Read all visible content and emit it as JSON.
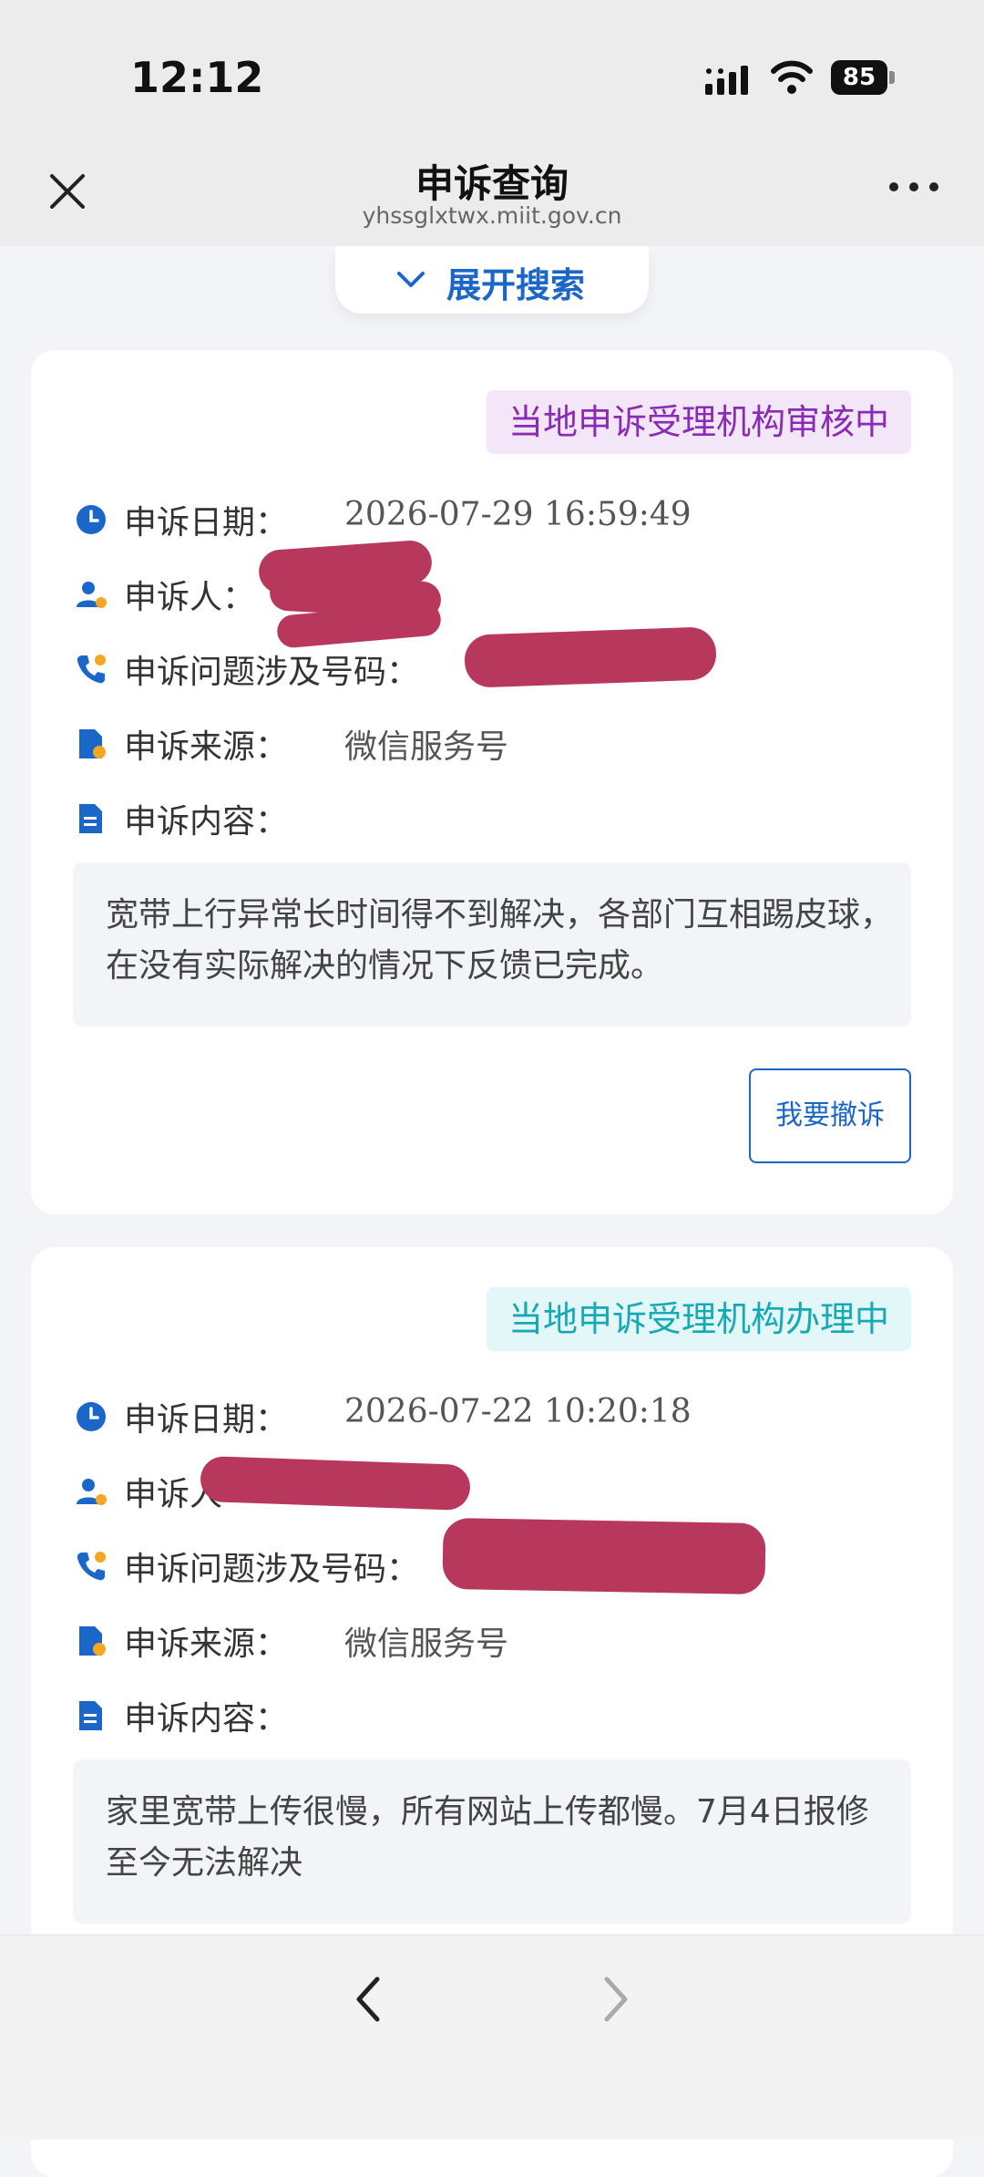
{
  "status_bar": {
    "time": "12:12",
    "battery": "85"
  },
  "nav": {
    "title": "申诉查询",
    "url": "yhssglxtwx.miit.gov.cn",
    "close_icon": "close-icon",
    "more_icon": "more-icon"
  },
  "expand_search": {
    "label": "展开搜索",
    "icon": "chevron-down-icon"
  },
  "labels": {
    "date": "申诉日期：",
    "person": "申诉人：",
    "number": "申诉问题涉及号码：",
    "source": "申诉来源：",
    "content": "申诉内容："
  },
  "labels_partial": {
    "person": "申诉人"
  },
  "complaints": [
    {
      "status": "当地申诉受理机构审核中",
      "status_color": "#8a2bb5",
      "date": "2026-07-29 16:59:49",
      "source": "微信服务号",
      "content": "宽带上行异常长时间得不到解决，各部门互相踢皮球，在没有实际解决的情况下反馈已完成。",
      "action_label": "我要撤诉"
    },
    {
      "status": "当地申诉受理机构办理中",
      "status_color": "#16a9b6",
      "date": "2026-07-22 10:20:18",
      "source": "微信服务号",
      "content": "家里宽带上传很慢，所有网站上传都慢。7月4日报修至今无法解决"
    }
  ],
  "bottom_nav": {
    "back_icon": "chevron-left-icon",
    "forward_icon": "chevron-right-icon"
  },
  "colors": {
    "accent": "#1a66c9",
    "redaction": "#b8375c"
  }
}
